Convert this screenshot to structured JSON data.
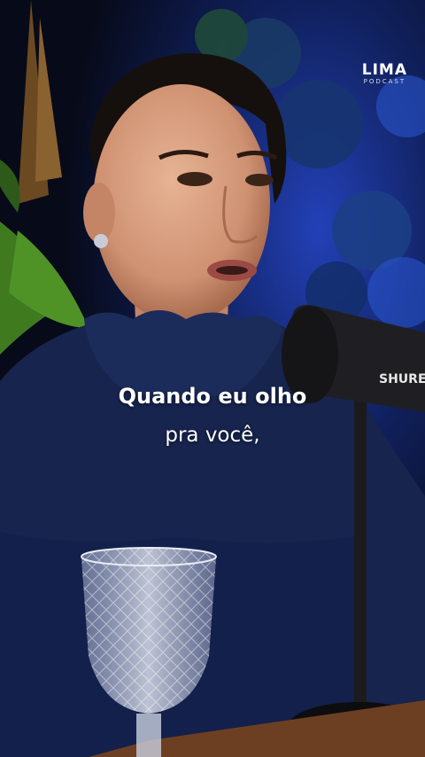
{
  "logo": {
    "main": "LIMA",
    "sub": "PODCAST"
  },
  "mic_brand": "SHURE",
  "subtitle": {
    "line1": "Quando eu olho",
    "line2": "pra você,"
  }
}
